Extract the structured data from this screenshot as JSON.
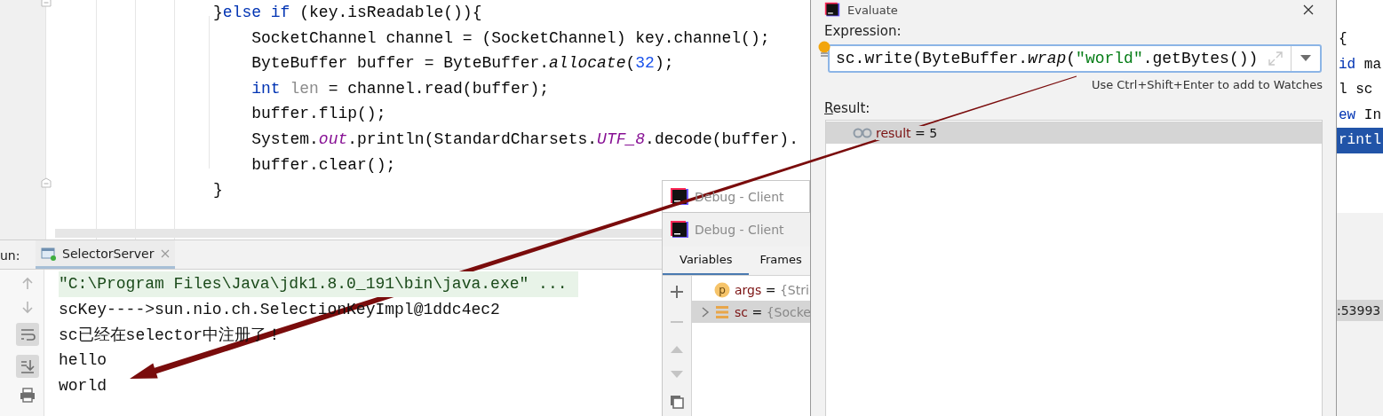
{
  "editor": {
    "code_lines": [
      {
        "fold": true,
        "tokens": [
          {
            "text": "}",
            "kind": "plain"
          },
          {
            "text": "else if",
            "kind": "keyword"
          },
          {
            "text": " (key.isReadable()){",
            "kind": "plain"
          }
        ]
      },
      {
        "fold": false,
        "tokens": [
          {
            "text": "    SocketChannel channel = (SocketChannel) key.channel();",
            "kind": "plain"
          }
        ]
      },
      {
        "fold": false,
        "tokens": [
          {
            "text": "    ByteBuffer buffer = ByteBuffer.",
            "kind": "plain"
          },
          {
            "text": "allocate",
            "kind": "method"
          },
          {
            "text": "(",
            "kind": "plain"
          },
          {
            "text": "32",
            "kind": "number"
          },
          {
            "text": ");",
            "kind": "plain"
          }
        ]
      },
      {
        "fold": false,
        "tokens": [
          {
            "text": "    int",
            "kind": "keyword"
          },
          {
            "text": " len",
            "kind": "local"
          },
          {
            "text": " = channel.read(buffer);",
            "kind": "plain"
          }
        ]
      },
      {
        "fold": false,
        "tokens": [
          {
            "text": "    buffer.flip();",
            "kind": "plain"
          }
        ]
      },
      {
        "fold": false,
        "tokens": [
          {
            "text": "    System.",
            "kind": "plain"
          },
          {
            "text": "out",
            "kind": "static"
          },
          {
            "text": ".println(StandardCharsets.",
            "kind": "plain"
          },
          {
            "text": "UTF_8",
            "kind": "static"
          },
          {
            "text": ".decode(buffer).",
            "kind": "plain"
          }
        ]
      },
      {
        "fold": false,
        "tokens": [
          {
            "text": "    buffer.clear();",
            "kind": "plain"
          }
        ]
      },
      {
        "fold": true,
        "tokens": [
          {
            "text": "}",
            "kind": "plain"
          }
        ]
      }
    ]
  },
  "side_editor": {
    "code_lines": [
      {
        "selected": false,
        "tokens": [
          {
            "text": "{",
            "kind": "plain"
          }
        ]
      },
      {
        "selected": false,
        "tokens": [
          {
            "text": "id",
            "kind": "keyword"
          },
          {
            "text": " ma",
            "kind": "plain"
          }
        ]
      },
      {
        "selected": false,
        "tokens": [
          {
            "text": "l sc",
            "kind": "plain"
          }
        ]
      },
      {
        "selected": false,
        "tokens": [
          {
            "text": "ew",
            "kind": "keyword"
          },
          {
            "text": " In",
            "kind": "plain"
          }
        ]
      },
      {
        "selected": true,
        "tokens": [
          {
            "text": "rintl",
            "kind": "plain"
          }
        ]
      }
    ],
    "variable_tail": ":53993"
  },
  "run_panel": {
    "label": "un:",
    "tabs": [
      {
        "label": "SelectorServer",
        "selected": true
      }
    ],
    "console_lines": [
      {
        "text": "\"C:\\Program Files\\Java\\jdk1.8.0_191\\bin\\java.exe\" ...",
        "kind": "command"
      },
      {
        "text": "scKey---->sun.nio.ch.SelectionKeyImpl@1ddc4ec2",
        "kind": "output"
      },
      {
        "text": "sc已经在selector中注册了！",
        "kind": "output"
      },
      {
        "text": "hello",
        "kind": "output"
      },
      {
        "text": "world",
        "kind": "output"
      }
    ]
  },
  "debug_windows": [
    {
      "title": "Debug - Client"
    },
    {
      "title": "Debug - Client"
    }
  ],
  "debug_panel": {
    "tabs": [
      {
        "label": "Variables",
        "selected": true
      },
      {
        "label": "Frames",
        "selected": false
      }
    ],
    "variables": [
      {
        "kind": "param",
        "badge": "p",
        "name": "args",
        "operator": "=",
        "value": "{Stri",
        "selected": false,
        "expandable": false
      },
      {
        "kind": "field",
        "name": "sc",
        "operator": "=",
        "value": "{Socke",
        "selected": true,
        "expandable": true
      }
    ]
  },
  "evaluate_dialog": {
    "title": "Evaluate",
    "expression_label": "Expression:",
    "expression": [
      {
        "text": "sc.write(ByteBuffer.",
        "kind": "plain"
      },
      {
        "text": "wrap",
        "kind": "method"
      },
      {
        "text": "(",
        "kind": "plain"
      },
      {
        "text": "\"world\"",
        "kind": "string"
      },
      {
        "text": ".getBytes())",
        "kind": "plain"
      }
    ],
    "hint": "Use Ctrl+Shift+Enter to add to Watches",
    "result_label": "Result:",
    "results": [
      {
        "name": "result",
        "operator": "=",
        "value": "5",
        "selected": true
      }
    ]
  }
}
